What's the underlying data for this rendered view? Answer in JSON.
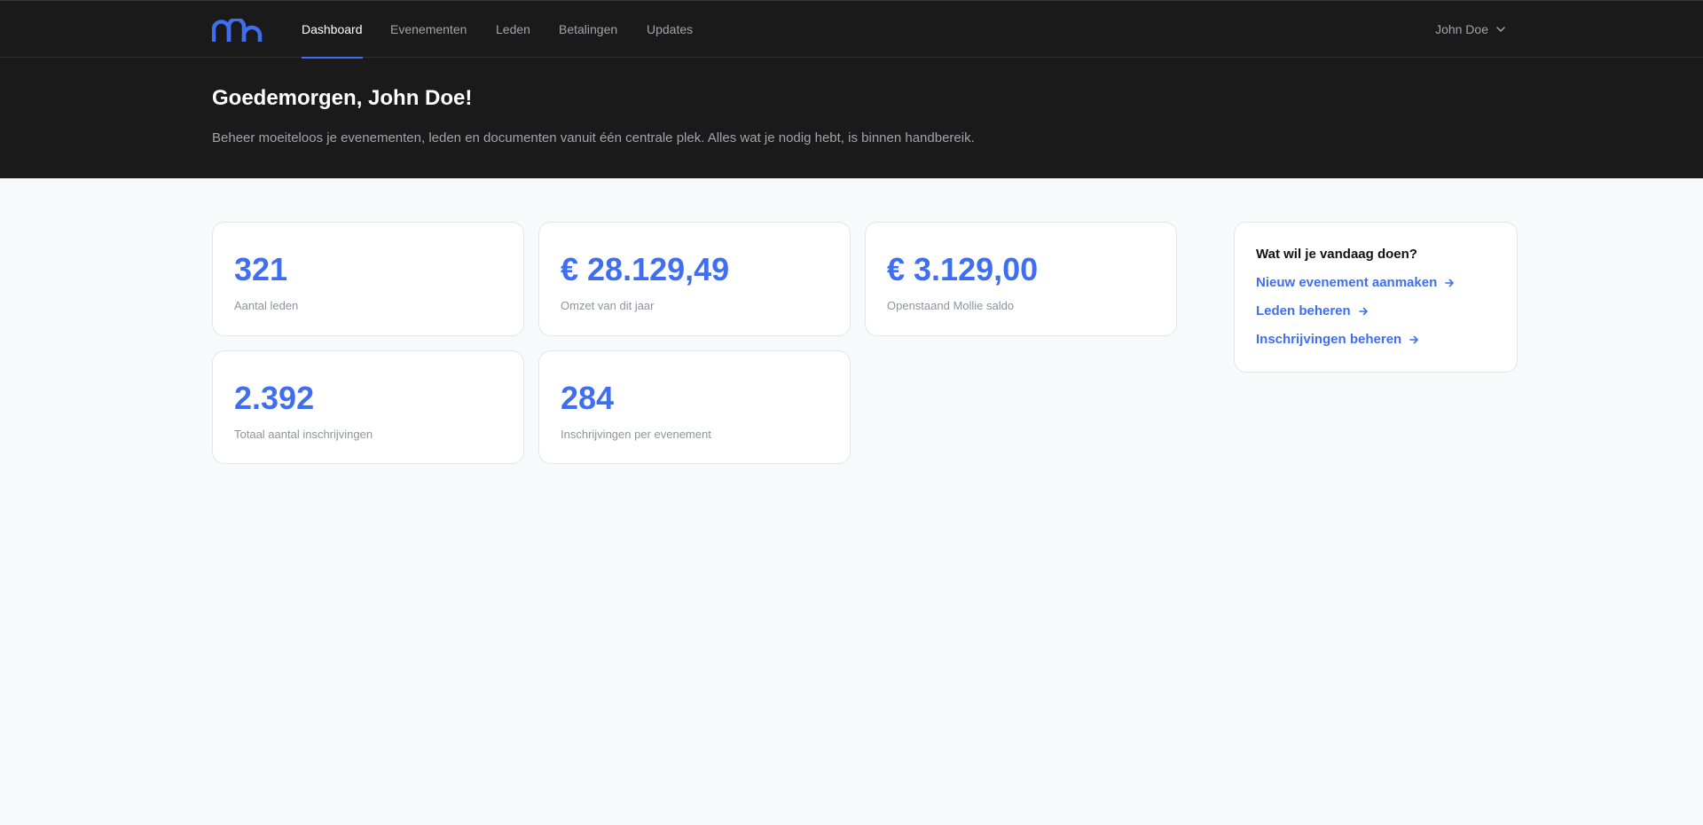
{
  "nav": {
    "items": [
      {
        "label": "Dashboard",
        "active": true
      },
      {
        "label": "Evenementen",
        "active": false
      },
      {
        "label": "Leden",
        "active": false
      },
      {
        "label": "Betalingen",
        "active": false
      },
      {
        "label": "Updates",
        "active": false
      }
    ],
    "user": "John Doe"
  },
  "hero": {
    "title": "Goedemorgen, John Doe!",
    "subtitle": "Beheer moeiteloos je evenementen, leden en documenten vanuit één centrale plek. Alles wat je nodig hebt, is binnen handbereik."
  },
  "stats": [
    {
      "value": "321",
      "label": "Aantal leden"
    },
    {
      "value": "€ 28.129,49",
      "label": "Omzet van dit jaar"
    },
    {
      "value": "€ 3.129,00",
      "label": "Openstaand Mollie saldo"
    },
    {
      "value": "2.392",
      "label": "Totaal aantal inschrijvingen"
    },
    {
      "value": "284",
      "label": "Inschrijvingen per evenement"
    }
  ],
  "actions": {
    "title": "Wat wil je vandaag doen?",
    "links": [
      {
        "label": "Nieuw evenement aanmaken"
      },
      {
        "label": "Leden beheren"
      },
      {
        "label": "Inschrijvingen beheren"
      }
    ]
  },
  "colors": {
    "accent": "#3f6ff0",
    "header_bg": "#1a1a1a",
    "page_bg": "#f8f9fb"
  },
  "icons": {
    "logo": "brand-logo",
    "user_chevron": "chevron-down-icon",
    "action_arrow": "arrow-right-icon"
  }
}
